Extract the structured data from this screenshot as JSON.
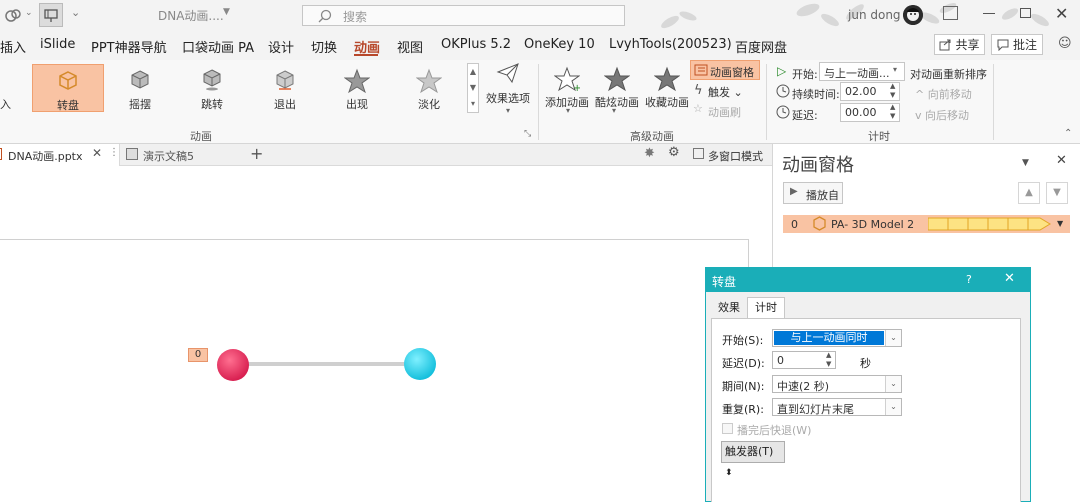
{
  "titlebar": {
    "doc_title": "DNA动画....",
    "search_placeholder": "搜索",
    "user_name": "jun dong"
  },
  "menu": {
    "tabs": [
      "插入",
      "iSlide",
      "PPT神器导航",
      "口袋动画 PA",
      "设计",
      "切换",
      "动画",
      "视图",
      "OKPlus 5.2",
      "OneKey 10",
      "LvyhTools(200523)",
      "百度网盘"
    ],
    "active_tab": "动画",
    "share_label": "共享",
    "comment_label": "批注"
  },
  "ribbon": {
    "animation_items": [
      "入",
      "转盘",
      "摇摆",
      "跳转",
      "退出",
      "出现",
      "淡化"
    ],
    "selected_item": "转盘",
    "effect_options_label": "效果选项",
    "group_animation_label": "动画",
    "add_animation_label": "添加动画",
    "cool_animation_label": "酷炫动画",
    "collect_animation_label": "收藏动画",
    "anim_pane_label": "动画窗格",
    "trigger_label": "触发",
    "anim_brush_label": "动画刷",
    "group_advanced_label": "高级动画",
    "start_label": "开始:",
    "start_value": "与上一动画...",
    "duration_label": "持续时间:",
    "duration_value": "02.00",
    "delay_label": "延迟:",
    "delay_value": "00.00",
    "reorder_label": "对动画重新排序",
    "move_earlier_label": "向前移动",
    "move_later_label": "向后移动",
    "group_timing_label": "计时"
  },
  "docbar": {
    "tab1": "DNA动画.pptx",
    "tab2": "演示文稿5",
    "multiwindow_label": "多窗口模式"
  },
  "slide": {
    "anim_tag": "0",
    "colors": {
      "left_sphere": "#e8305f",
      "right_sphere": "#29d4ec",
      "bar": "#c8c8c8"
    }
  },
  "anim_pane": {
    "title": "动画窗格",
    "play_label": "播放自",
    "row_index": "0",
    "row_name": "PA- 3D Model 2"
  },
  "dialog": {
    "title": "转盘",
    "help": "?",
    "tab_effect": "效果",
    "tab_timing": "计时",
    "start_label": "开始(S):",
    "start_value": "与上一动画同时",
    "delay_label": "延迟(D):",
    "delay_value": "0",
    "delay_unit": "秒",
    "period_label": "期间(N):",
    "period_value": "中速(2 秒)",
    "repeat_label": "重复(R):",
    "repeat_value": "直到幻灯片末尾",
    "rewind_label": "播完后快退(W)",
    "trigger_label": "触发器(T)"
  },
  "colors": {
    "accent": "#b7472a",
    "selection": "#f9c3a3",
    "dialog_title": "#1aaeb8",
    "select_highlight": "#0078d7"
  }
}
